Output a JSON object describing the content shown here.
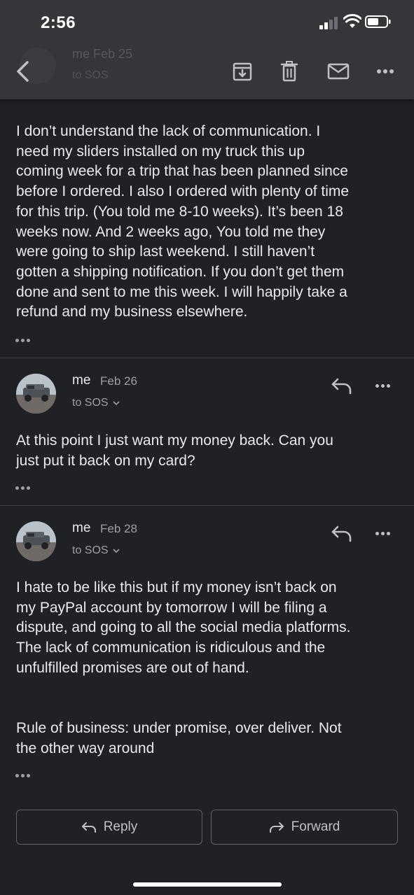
{
  "status_bar": {
    "time": "2:56"
  },
  "header": {
    "ghost_sender": "me  Feb 25",
    "ghost_to": "to SOS"
  },
  "messages": [
    {
      "body": "I don’t understand the lack of communication. I\nneed my sliders installed on my truck this up\ncoming week for a trip that has been planned since\nbefore I ordered. I also I ordered with plenty of time\nfor this trip. (You told me 8-10 weeks). It’s been 18\nweeks now. And 2 weeks ago, You told me they\nwere going to ship last weekend. I still haven’t\ngotten a shipping notification. If you don’t get them\ndone and sent to me this week. I will happily take a\nrefund and my business elsewhere."
    },
    {
      "sender": "me",
      "date": "Feb 26",
      "to": "to SOS",
      "body": "At this point I just want my money back. Can you\njust put it back on my card?"
    },
    {
      "sender": "me",
      "date": "Feb 28",
      "to": "to SOS",
      "body": "I hate to be like this but if my money isn’t back on\nmy PayPal account by tomorrow I will be filing a\ndispute, and going to all the social media platforms.\nThe lack of communication is ridiculous and the\nunfulfilled promises are out of hand.\n\n\nRule of business: under promise, over deliver. Not\nthe other way around"
    }
  ],
  "actions": {
    "reply_label": "Reply",
    "forward_label": "Forward"
  },
  "colors": {
    "background": "#202124",
    "header": "#35363a",
    "text": "#e8eaed",
    "secondary_text": "#9aa0a6",
    "divider": "#3c4043"
  }
}
